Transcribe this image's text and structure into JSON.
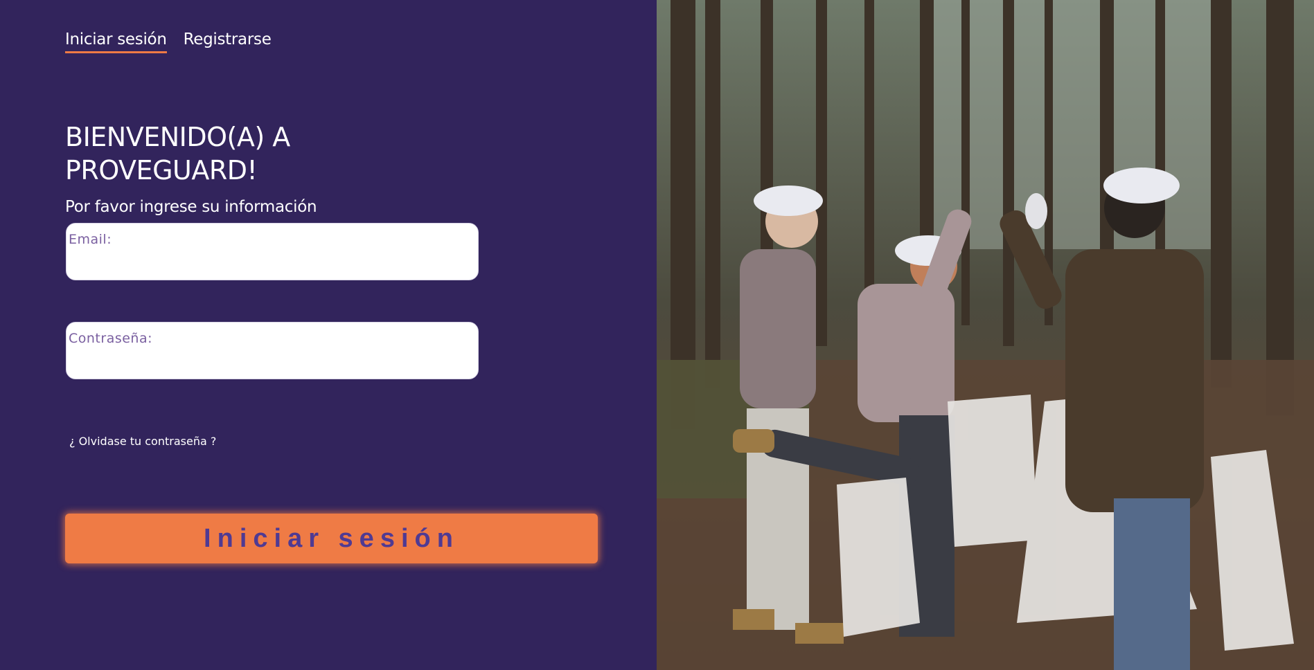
{
  "tabs": [
    {
      "label": "Iniciar sesión",
      "active": true
    },
    {
      "label": "Registrarse",
      "active": false
    }
  ],
  "welcome": {
    "title_line1": "BIENVENIDO(A) A",
    "title_line2": "PROVEGUARD!",
    "subtitle": "Por favor ingrese su información"
  },
  "form": {
    "email_label": "Email:",
    "email_value": "",
    "password_label": "Contraseña:",
    "password_value": "",
    "forgot_label": "¿ Olvidase tu contraseña ?",
    "submit_label": "Iniciar sesión"
  },
  "colors": {
    "background": "#32245c",
    "accent": "#ef7b45",
    "button_text": "#4f3a93",
    "field_label": "#7a5fa0"
  },
  "photo": {
    "icon": "forest-volunteers-photo"
  }
}
